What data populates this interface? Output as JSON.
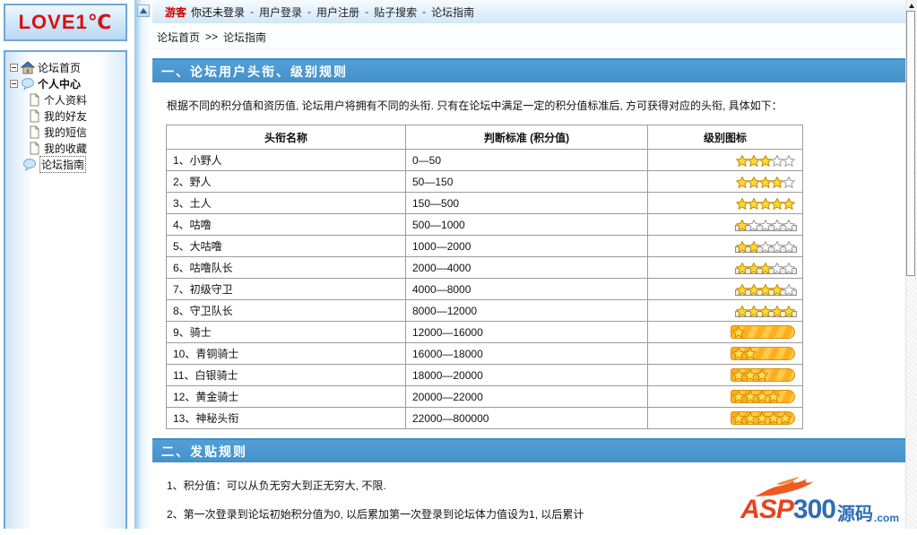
{
  "logo": {
    "text": "LOVE1℃"
  },
  "topbar": {
    "guest_label": "游客",
    "status": "你还未登录",
    "separator": "-",
    "links": [
      "用户登录",
      "用户注册",
      "贴子搜索",
      "论坛指南"
    ]
  },
  "breadcrumb": {
    "home": "论坛首页",
    "separator": ">>",
    "current": "论坛指南"
  },
  "sidebar": {
    "items": [
      {
        "label": "论坛首页",
        "icon": "home-icon",
        "level": 0,
        "expandable": true
      },
      {
        "label": "个人中心",
        "icon": "balloon-icon",
        "level": 0,
        "expandable": true,
        "bold": true
      },
      {
        "label": "个人资料",
        "icon": "page-icon",
        "level": 1
      },
      {
        "label": "我的好友",
        "icon": "page-icon",
        "level": 1
      },
      {
        "label": "我的短信",
        "icon": "page-icon",
        "level": 1
      },
      {
        "label": "我的收藏",
        "icon": "page-icon",
        "level": 1
      },
      {
        "label": "论坛指南",
        "icon": "balloon-icon",
        "level": 0,
        "selected": true
      }
    ]
  },
  "section1": {
    "title": "一、论坛用户头衔、级别规则",
    "description": "根据不同的积分值和资历值, 论坛用户将拥有不同的头衔. 只有在论坛中满足一定的积分值标准后, 方可获得对应的头衔, 具体如下："
  },
  "table": {
    "headers": [
      "头衔名称",
      "判断标准 (积分值)",
      "级别图标"
    ],
    "rows": [
      {
        "name": "1、小野人",
        "range": "0—50",
        "icon": "stars",
        "gold": 3,
        "empty": 2
      },
      {
        "name": "2、野人",
        "range": "50—150",
        "icon": "stars",
        "gold": 4,
        "empty": 1
      },
      {
        "name": "3、土人",
        "range": "150—500",
        "icon": "stars",
        "gold": 5,
        "empty": 0
      },
      {
        "name": "4、咕噜",
        "range": "500—1000",
        "icon": "stars-bar",
        "gold": 1,
        "empty": 4
      },
      {
        "name": "5、大咕噜",
        "range": "1000—2000",
        "icon": "stars-bar",
        "gold": 2,
        "empty": 3
      },
      {
        "name": "6、咕噜队长",
        "range": "2000—4000",
        "icon": "stars-bar",
        "gold": 3,
        "empty": 2
      },
      {
        "name": "7、初级守卫",
        "range": "4000—8000",
        "icon": "stars-bar",
        "gold": 4,
        "empty": 1
      },
      {
        "name": "8、守卫队长",
        "range": "8000—12000",
        "icon": "stars-bar",
        "gold": 5,
        "empty": 0
      },
      {
        "name": "9、骑士",
        "range": "12000—16000",
        "icon": "banner",
        "gold": 1,
        "empty": 0
      },
      {
        "name": "10、青铜骑士",
        "range": "16000—18000",
        "icon": "banner",
        "gold": 2,
        "empty": 0
      },
      {
        "name": "11、白银骑士",
        "range": "18000—20000",
        "icon": "banner",
        "gold": 3,
        "empty": 0
      },
      {
        "name": "12、黄金骑士",
        "range": "20000—22000",
        "icon": "banner",
        "gold": 4,
        "empty": 0
      },
      {
        "name": "13、神秘头衔",
        "range": "22000—800000",
        "icon": "banner",
        "gold": 5,
        "empty": 0
      }
    ]
  },
  "section2": {
    "title": "二、发贴规则",
    "rules": [
      "1、积分值：可以从负无穷大到正无穷大, 不限.",
      "2、第一次登录到论坛初始积分值为0, 以后累加第一次登录到论坛体力值设为1, 以后累计"
    ]
  },
  "watermark": {
    "asp": "ASP",
    "num": "300",
    "cn": "源码",
    "com": ".com"
  },
  "colors": {
    "accent_blue": "#4B9CD3",
    "topbar_blue": "#D7E9F8",
    "logo_red": "#D91111",
    "star_gold": "#FFD83B",
    "banner_orange": "#FFB327",
    "border_blue": "#6FA6D8"
  }
}
